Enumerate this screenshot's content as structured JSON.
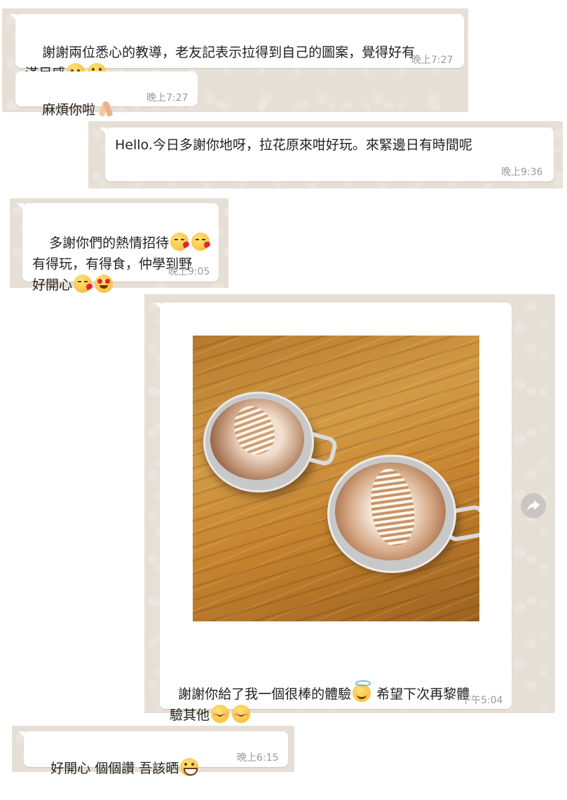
{
  "messages": [
    {
      "id": "m1",
      "text": "謝謝兩位悉心的教導，老友記表示拉得到自己的圖案，覺得好有",
      "text2": "滿足感",
      "emoji": [
        "smiling-face-icon",
        "grinning-face-icon"
      ],
      "time": "晚上7:27"
    },
    {
      "id": "m2",
      "text": "麻煩你啦",
      "emoji": [
        "folded-hands-icon"
      ],
      "time": "晚上7:27"
    },
    {
      "id": "m3",
      "text": "Hello.今日多謝你地呀，拉花原來咁好玩。來緊邊日有時間呢",
      "time": "晚上9:36"
    },
    {
      "id": "m4",
      "line1": "多謝你們的熱情招待",
      "line2": "有得玩，有得食，仲學到野",
      "line3": "好開心",
      "emoji": [
        "face-blowing-kiss-icon",
        "face-blowing-kiss-icon",
        "face-blowing-kiss-icon",
        "heart-eyes-icon"
      ],
      "time": "晚上9:05"
    },
    {
      "id": "m5",
      "caption1": "謝謝你給了我一個很棒的體驗",
      "caption1b": " 希望下次再黎體",
      "caption2": "驗其他",
      "emoji": [
        "smiling-face-with-halo-icon",
        "blushing-face-icon",
        "blushing-face-icon"
      ],
      "time": "下午5:04"
    },
    {
      "id": "m6",
      "text": "好開心 個個讚 吾該晒",
      "emoji": [
        "grinning-face-icon"
      ],
      "time": "晚上6:15"
    }
  ],
  "colors": {
    "chat_bg": "#e6dfd6",
    "bubble": "#ffffff",
    "timestamp": "#9a9a9a",
    "forward_button": "#c9c6c1"
  }
}
